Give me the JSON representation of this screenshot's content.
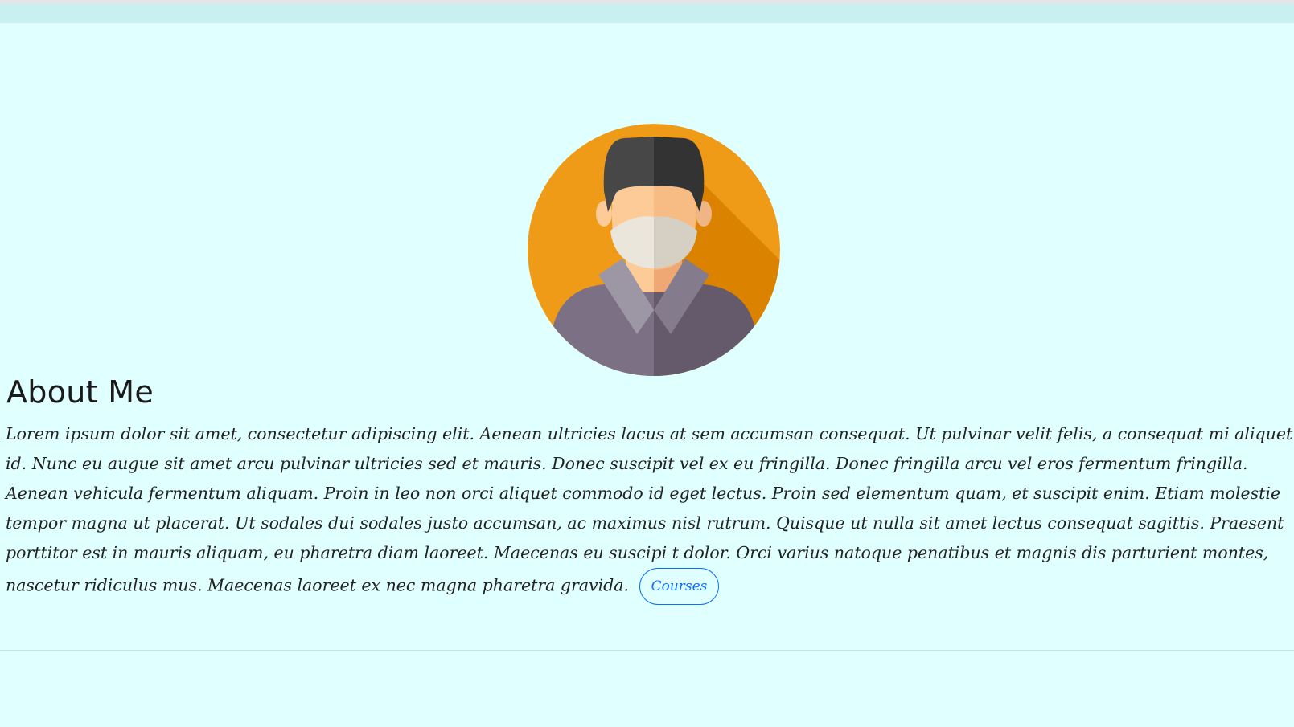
{
  "header": {
    "bar_color": "#c8f0f0"
  },
  "profile": {
    "avatar_icon": "masked-man-avatar-icon",
    "colors": {
      "circle": "#ef9b17",
      "shadow": "#db8200",
      "hair": "#3a3a3a",
      "skin": "#fccb97",
      "mask": "#e7e4da",
      "shirt": "#7c7085"
    }
  },
  "about": {
    "title": "About Me",
    "body": "Lorem ipsum dolor sit amet, consectetur adipiscing elit. Aenean ultricies lacus at sem accumsan consequat. Ut pulvinar velit felis, a consequat mi aliquet id. Nunc eu augue sit amet arcu pulvinar ultricies sed et mauris. Donec suscipit vel ex eu fringilla. Donec fringilla arcu vel eros fermentum fringilla. Aenean vehicula fermentum aliquam. Proin in leo non orci aliquet commodo id eget lectus. Proin sed elementum quam, et suscipit enim. Etiam molestie tempor magna ut placerat. Ut sodales dui sodales justo accumsan, ac maximus nisl rutrum. Quisque ut nulla sit amet lectus consequat sagittis. Praesent porttitor est in mauris aliquam, eu pharetra diam laoreet. Maecenas eu suscipi t dolor. Orci varius natoque penatibus et magnis dis parturient montes, nascetur ridiculus mus. Maecenas laoreet ex nec magna pharetra gravida.",
    "button_label": "Courses",
    "accent": "#0d6efd"
  }
}
